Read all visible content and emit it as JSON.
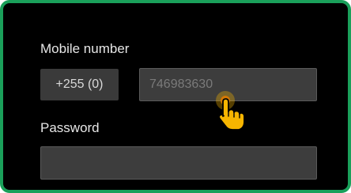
{
  "form": {
    "mobile_label": "Mobile number",
    "country_code": "+255 (0)",
    "phone_placeholder": "746983630",
    "password_label": "Password",
    "password_placeholder": ""
  },
  "pointer": {
    "icon": "hand-pointer-icon",
    "color": "#f5b400"
  },
  "colors": {
    "frame_border": "#1aa05a",
    "background": "#000000"
  }
}
